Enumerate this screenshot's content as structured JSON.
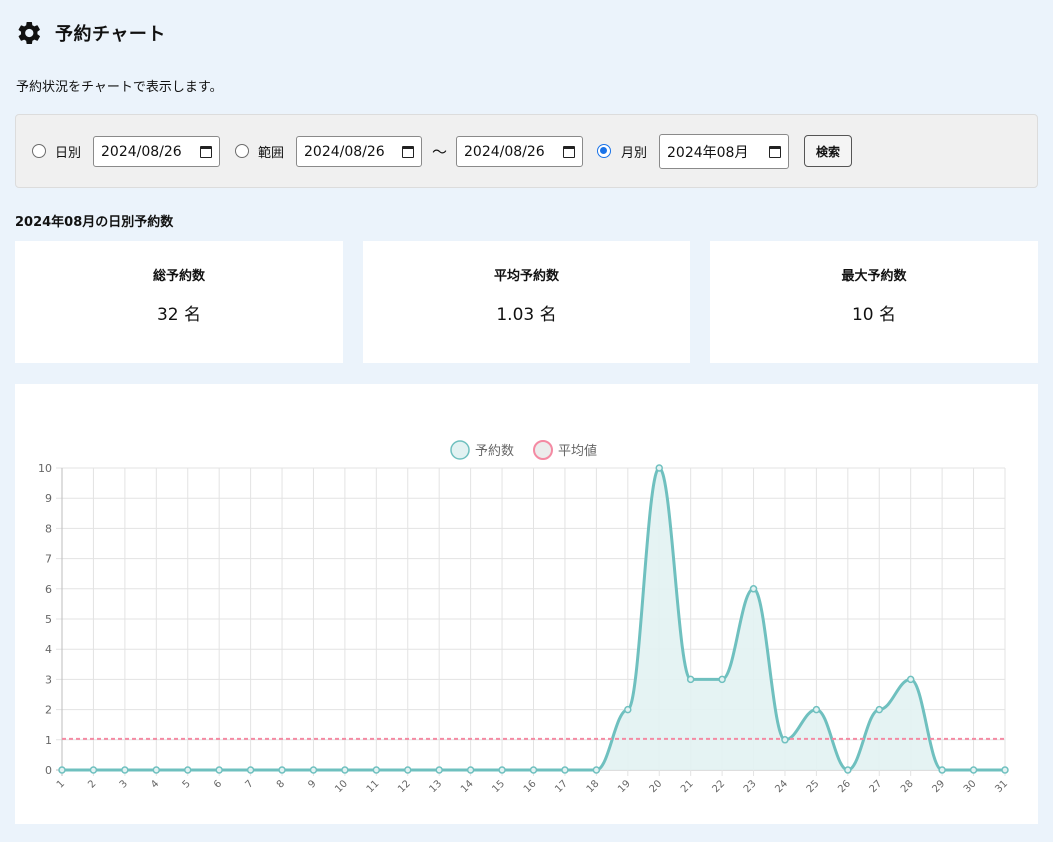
{
  "header": {
    "title": "予約チャート",
    "icon": "gear-icon"
  },
  "description": "予約状況をチャートで表示します。",
  "filters": {
    "daily": {
      "label": "日別",
      "date": "2024/08/26",
      "checked": false
    },
    "range": {
      "label": "範囲",
      "from": "2024/08/26",
      "to": "2024/08/26",
      "separator": "〜",
      "checked": false
    },
    "monthly": {
      "label": "月別",
      "month": "2024年08月",
      "checked": true
    },
    "search_label": "検索"
  },
  "section_title": "2024年08月の日別予約数",
  "stats": {
    "total": {
      "label": "総予約数",
      "value": "32 名"
    },
    "average": {
      "label": "平均予約数",
      "value": "1.03 名"
    },
    "max": {
      "label": "最大予約数",
      "value": "10 名"
    }
  },
  "colors": {
    "accent": "#1a73e8",
    "series_line": "#6fc0bf",
    "series_fill": "#e2f2f2",
    "average_line": "#f48aa3"
  },
  "chart_data": {
    "type": "line",
    "categories": [
      "1",
      "2",
      "3",
      "4",
      "5",
      "6",
      "7",
      "8",
      "9",
      "10",
      "11",
      "12",
      "13",
      "14",
      "15",
      "16",
      "17",
      "18",
      "19",
      "20",
      "21",
      "22",
      "23",
      "24",
      "25",
      "26",
      "27",
      "28",
      "29",
      "30",
      "31"
    ],
    "series": [
      {
        "name": "予約数",
        "values": [
          0,
          0,
          0,
          0,
          0,
          0,
          0,
          0,
          0,
          0,
          0,
          0,
          0,
          0,
          0,
          0,
          0,
          0,
          2,
          10,
          3,
          3,
          6,
          1,
          2,
          0,
          2,
          3,
          0,
          0,
          0
        ],
        "fill": true
      },
      {
        "name": "平均値",
        "values": [
          1.03,
          1.03,
          1.03,
          1.03,
          1.03,
          1.03,
          1.03,
          1.03,
          1.03,
          1.03,
          1.03,
          1.03,
          1.03,
          1.03,
          1.03,
          1.03,
          1.03,
          1.03,
          1.03,
          1.03,
          1.03,
          1.03,
          1.03,
          1.03,
          1.03,
          1.03,
          1.03,
          1.03,
          1.03,
          1.03,
          1.03
        ],
        "dashed": true
      }
    ],
    "ylim": [
      0,
      10
    ],
    "yticks": [
      "0",
      "1",
      "2",
      "3",
      "4",
      "5",
      "6",
      "7",
      "8",
      "9",
      "10"
    ],
    "grid": true,
    "legend": "top-center"
  }
}
